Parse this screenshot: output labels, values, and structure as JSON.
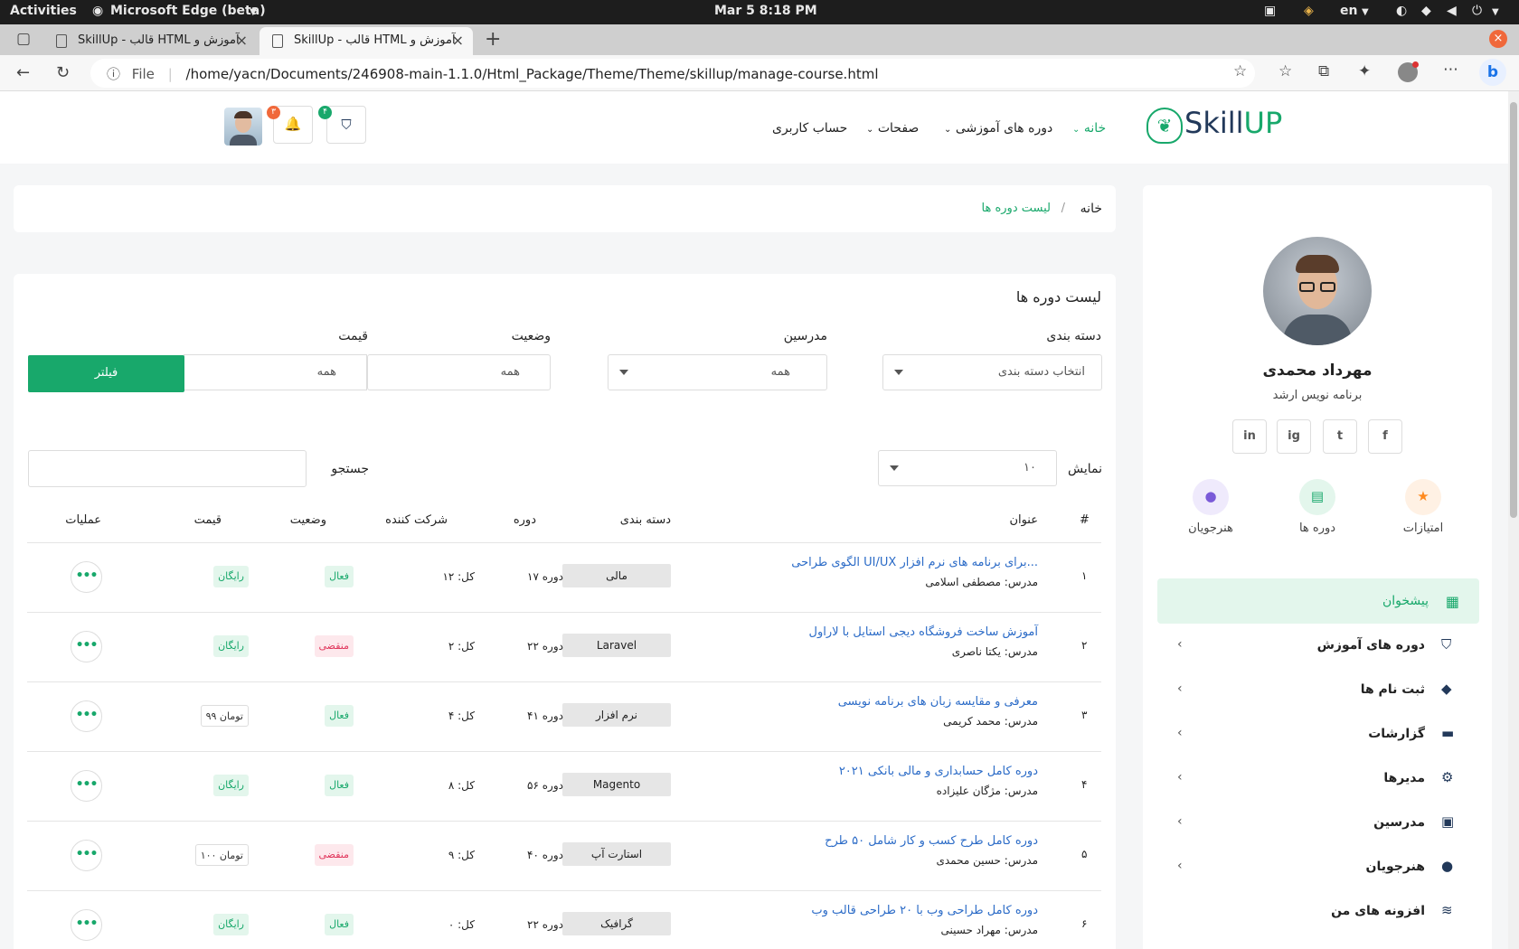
{
  "system": {
    "activities": "Activities",
    "app_name": "Microsoft Edge (beta)",
    "clock": "Mar 5   8:18 PM",
    "lang": "en"
  },
  "browser": {
    "tabs": [
      {
        "label": "SkillUp - قالب HTML آموزش و",
        "active": false
      },
      {
        "label": "SkillUp - قالب HTML آموزش و",
        "active": true
      }
    ],
    "new_tab": "+",
    "url_prefix": "File",
    "url": "/home/yacn/Documents/246908-main-1.1.0/Html_Package/Theme/Theme/skillup/manage-course.html"
  },
  "header": {
    "logo_a": "Skill",
    "logo_b": "UP",
    "nav": [
      {
        "label": "خانه",
        "active": true,
        "dropdown": true
      },
      {
        "label": "دوره های آموزشی",
        "active": false,
        "dropdown": true
      },
      {
        "label": "صفحات",
        "active": false,
        "dropdown": true
      },
      {
        "label": "حساب کاربری",
        "active": false,
        "dropdown": false
      }
    ],
    "cart_count": "۴",
    "notif_count": "۳"
  },
  "breadcrumb": {
    "home": "خانه",
    "sep": "/",
    "current": "لیست دوره ها"
  },
  "panel": {
    "title": "لیست دوره ها",
    "filters": {
      "category_label": "دسته بندی",
      "category_value": "انتخاب دسته بندی",
      "teacher_label": "مدرسین",
      "teacher_value": "همه",
      "status_label": "وضعیت",
      "status_value": "همه",
      "price_label": "قیمت",
      "price_value": "همه",
      "filter_button": "فیلتر"
    },
    "show_label": "نمایش",
    "show_value": "۱۰",
    "search_label": "جستجو",
    "columns": [
      "#",
      "عنوان",
      "دسته بندی",
      "دوره",
      "شرکت کننده",
      "وضعیت",
      "قیمت",
      "عملیات"
    ],
    "rows": [
      {
        "num": "۱",
        "title": "الگوی طراحی UI/UX برای برنامه های نرم افزار...",
        "teacher": "مدرس: مصطفی اسلامی",
        "category": "مالی",
        "lessons": "۱۷ دوره",
        "students": "کل: ۱۲",
        "status": "فعال",
        "status_type": "active",
        "price": "رایگان",
        "price_type": "free"
      },
      {
        "num": "۲",
        "title": "آموزش ساخت فروشگاه دیجی استایل با لاراول",
        "teacher": "مدرس: یکتا ناصری",
        "category": "Laravel",
        "lessons": "۲۲ دوره",
        "students": "کل: ۲",
        "status": "منقضی",
        "status_type": "expired",
        "price": "رایگان",
        "price_type": "free"
      },
      {
        "num": "۳",
        "title": "معرفی و مقایسه زبان های برنامه نویسی",
        "teacher": "مدرس: محمد کریمی",
        "category": "نرم افزار",
        "lessons": "۴۱ دوره",
        "students": "کل: ۴",
        "status": "فعال",
        "status_type": "active",
        "price": "۹۹ تومان",
        "price_type": "paid"
      },
      {
        "num": "۴",
        "title": "دوره کامل حسابداری و مالی بانکی ۲۰۲۱",
        "teacher": "مدرس: مژگان علیزاده",
        "category": "Magento",
        "lessons": "۵۶ دوره",
        "students": "کل: ۸",
        "status": "فعال",
        "status_type": "active",
        "price": "رایگان",
        "price_type": "free"
      },
      {
        "num": "۵",
        "title": "دوره کامل طرح کسب و کار شامل ۵۰ طرح",
        "teacher": "مدرس: حسین محمدی",
        "category": "استارت آپ",
        "lessons": "۴۰ دوره",
        "students": "کل: ۹",
        "status": "منقضی",
        "status_type": "expired",
        "price": "۱۰۰ تومان",
        "price_type": "paid"
      },
      {
        "num": "۶",
        "title": "دوره کامل طراحی وب با ۲۰ طراحی قالب وب",
        "teacher": "مدرس: مهراد حسینی",
        "category": "گرافیک",
        "lessons": "۲۲ دوره",
        "students": "کل: ۰",
        "status": "فعال",
        "status_type": "active",
        "price": "رایگان",
        "price_type": "free"
      }
    ],
    "dots": "•••"
  },
  "sidebar": {
    "name": "مهرداد محمدی",
    "role": "برنامه نویس ارشد",
    "socials": [
      "f",
      "t",
      "ig",
      "in"
    ],
    "stats": [
      {
        "label": "امتیازات",
        "icon": "star-icon",
        "color": "#ff8a1f",
        "bg": "#fff1e4"
      },
      {
        "label": "دوره ها",
        "icon": "file-icon",
        "color": "#18a86b",
        "bg": "#e3f6ec"
      },
      {
        "label": "هنرجویان",
        "icon": "user-icon",
        "color": "#7a5ad8",
        "bg": "#efeafc"
      }
    ],
    "menu": [
      {
        "label": "پیشخوان",
        "icon": "grid-icon",
        "active": true
      },
      {
        "label": "دوره های آموزش",
        "icon": "basket-icon",
        "active": false
      },
      {
        "label": "ثبت نام ها",
        "icon": "diamond-icon",
        "active": false
      },
      {
        "label": "گزارشات",
        "icon": "archive-icon",
        "active": false
      },
      {
        "label": "مدیرها",
        "icon": "user-cog-icon",
        "active": false
      },
      {
        "label": "مدرسین",
        "icon": "briefcase-icon",
        "active": false
      },
      {
        "label": "هنرجویان",
        "icon": "user-icon",
        "active": false
      },
      {
        "label": "افزونه های من",
        "icon": "layers-icon",
        "active": false
      }
    ]
  }
}
